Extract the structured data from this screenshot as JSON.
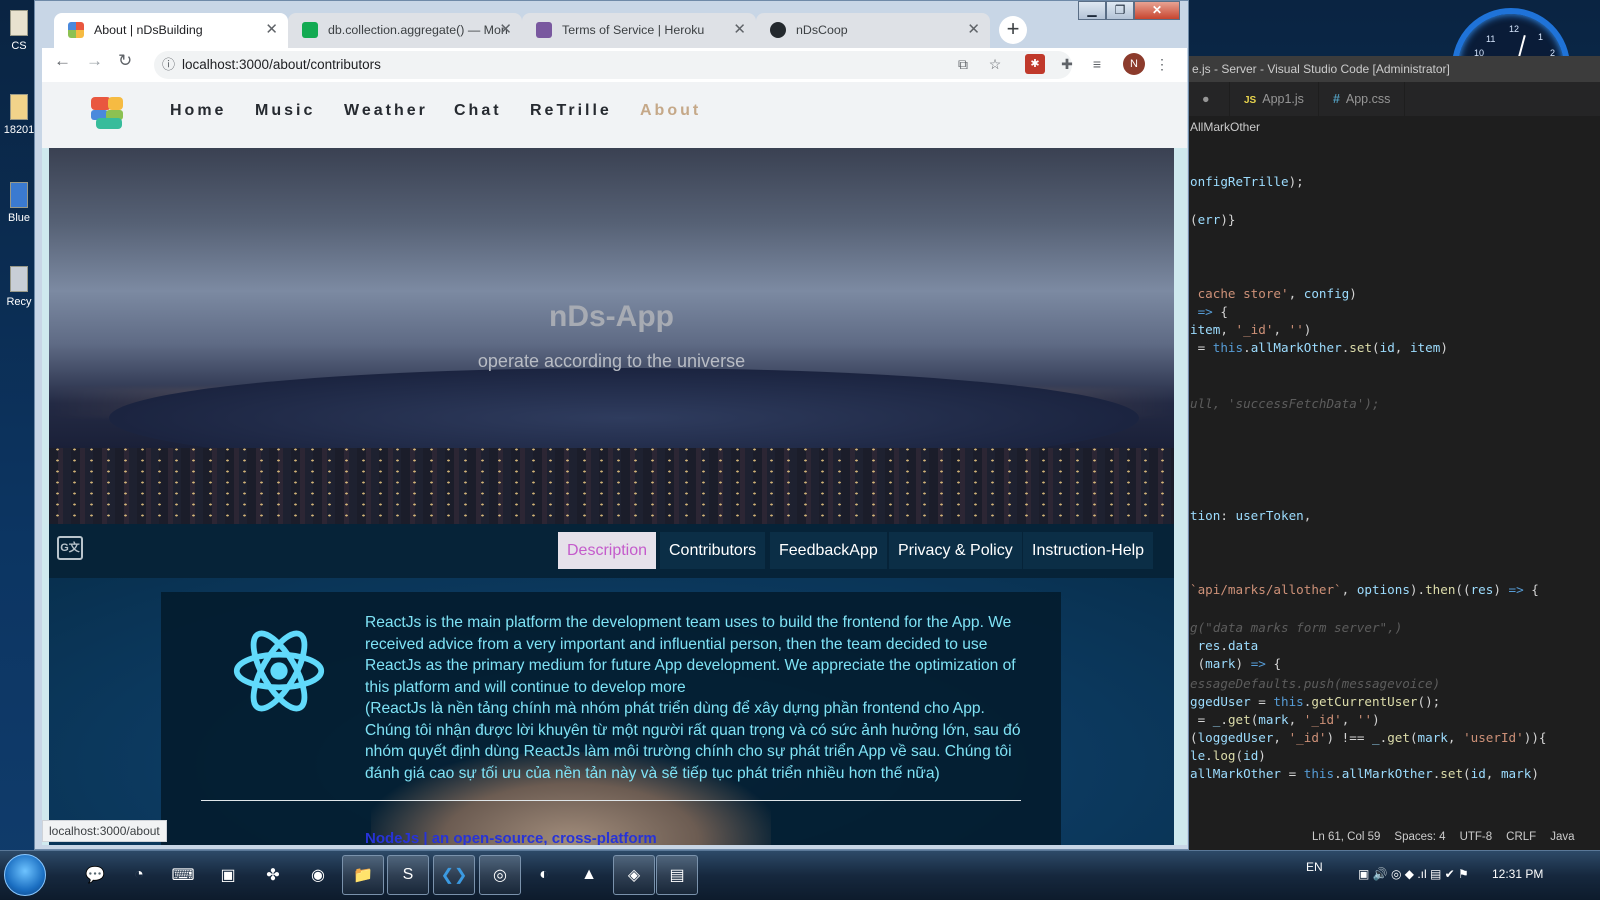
{
  "desktop": {
    "icons": [
      "CS",
      "18201",
      "Blue",
      "Recy"
    ],
    "clock_numbers": [
      "11",
      "12",
      "1",
      "2",
      "10"
    ]
  },
  "vscode": {
    "title": "e.js - Server - Visual Studio Code [Administrator]",
    "tabs": [
      {
        "label": "App1.js",
        "icon": "JS"
      },
      {
        "label": "App.css",
        "icon": "#"
      }
    ],
    "breadcrumb": "AllMarkOther",
    "status": {
      "position": "Ln 61, Col 59",
      "spaces": "Spaces: 4",
      "encoding": "UTF-8",
      "eol": "CRLF",
      "language": "Java"
    }
  },
  "chrome": {
    "tabs": [
      {
        "title": "About | nDsBuilding",
        "favicon_color": "#e9573f"
      },
      {
        "title": "db.collection.aggregate() — Mon",
        "favicon_color": "#13aa52"
      },
      {
        "title": "Terms of Service | Heroku",
        "favicon_color": "#79589f"
      },
      {
        "title": "nDsCoop",
        "favicon_color": "#24292e"
      }
    ],
    "url": "localhost:3000/about/contributors",
    "profile_initial": "N",
    "status_url": "localhost:3000/about"
  },
  "site": {
    "nav": [
      "Home",
      "Music",
      "Weather",
      "Chat",
      "ReTrille",
      "About"
    ],
    "active_nav": "About",
    "hero_title": "nDs-App",
    "hero_subtitle": "operate according to the universe",
    "translate_icon": "G文",
    "page_tabs": [
      "Description",
      "Contributors",
      "FeedbackApp",
      "Privacy & Policy",
      "Instruction-Help"
    ],
    "active_tab": "Description",
    "description_en": "ReactJs is the main platform the development team uses to build the frontend for the App. We received advice from a very important and influential person, then the team decided to use ReactJs as the primary medium for future App development. We appreciate the optimization of this platform and will continue to develop more",
    "description_vi": "(ReactJs là nền tảng chính mà nhóm phát triển dùng để xây dựng phần frontend cho App. Chúng tôi nhận được lời khuyên từ một người rất quan trọng và có sức ảnh hưởng lớn, sau đó nhóm quyết định dùng ReactJs làm môi trường chính cho sự phát triển App về sau. Chúng tôi đánh giá cao sự tối ưu của nền tản này và sẽ tiếp tục phát triển nhiều hơn thế nữa)",
    "next_line": "NodeJs | an open-source, cross-platform"
  },
  "taskbar": {
    "language": "EN",
    "time": "12:31 PM"
  },
  "colors": {
    "accent_nav": "#c5a888",
    "tab_active_text": "#c45bcb",
    "desc_text": "#7fe3f6",
    "react_logo": "#61dafb"
  }
}
